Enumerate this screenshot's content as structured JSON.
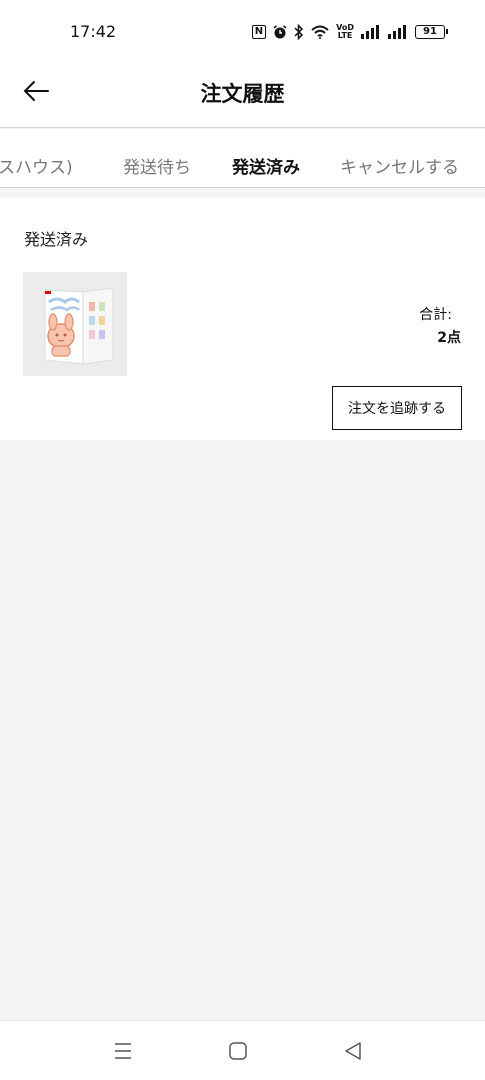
{
  "status_bar": {
    "time": "17:42",
    "nfc": "N",
    "volte": [
      "VoD",
      "LTE"
    ],
    "battery": "91",
    "icons": [
      "nfc-icon",
      "alarm-icon",
      "bluetooth-icon",
      "wifi-icon",
      "volte-icon",
      "signal-icon",
      "signal-icon",
      "battery-icon"
    ]
  },
  "header": {
    "title": "注文履歴",
    "back_icon": "arrow-left-icon"
  },
  "tabs": [
    {
      "label": "スハウス)"
    },
    {
      "label": "発送待ち"
    },
    {
      "label": "発送済み"
    },
    {
      "label": "キャンセルする"
    }
  ],
  "active_tab": "発送済み",
  "accent_color": "#e60012",
  "order": {
    "status": "発送済み",
    "total_label": "合計:",
    "total_value": "2点",
    "track_button": "注文を追跡する",
    "thumbnail": "product-figure-box-image"
  },
  "nav_bar": {
    "icons": [
      "menu-icon",
      "home-icon",
      "back-triangle-icon"
    ]
  }
}
